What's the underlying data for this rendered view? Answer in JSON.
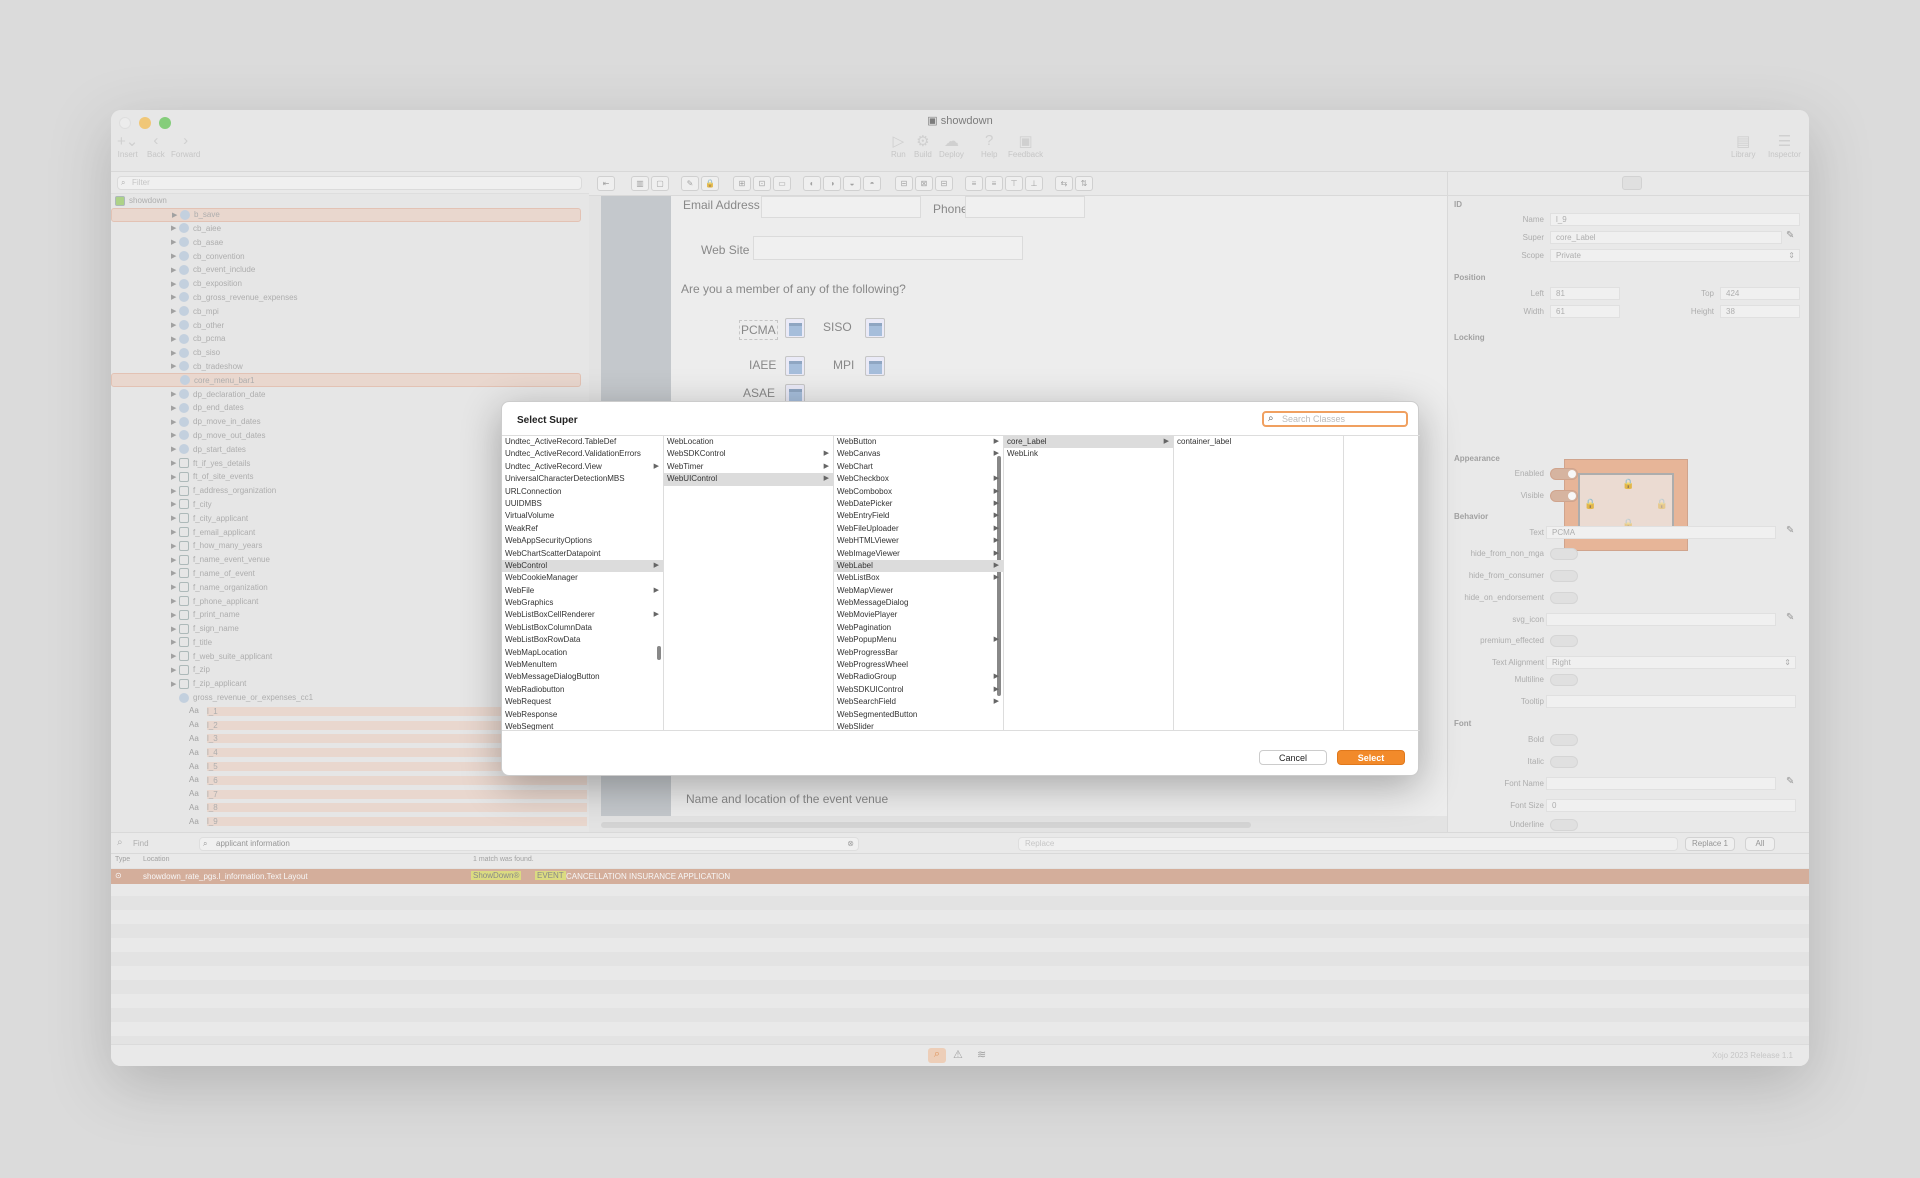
{
  "window": {
    "title": "showdown",
    "version": "Xojo 2023 Release 1.1"
  },
  "toolbar": {
    "left": [
      "Insert",
      "Back",
      "Forward"
    ],
    "mid": [
      "Run",
      "Build",
      "Deploy",
      "Help",
      "Feedback"
    ],
    "right": [
      "Library",
      "Inspector"
    ]
  },
  "navigator": {
    "filter_placeholder": "Filter",
    "root": "showdown",
    "items": [
      "b_save",
      "cb_aiee",
      "cb_asae",
      "cb_convention",
      "cb_event_include",
      "cb_exposition",
      "cb_gross_revenue_expenses",
      "cb_mpi",
      "cb_other",
      "cb_pcma",
      "cb_siso",
      "cb_tradeshow",
      "core_menu_bar1",
      "dp_declaration_date",
      "dp_end_dates",
      "dp_move_in_dates",
      "dp_move_out_dates",
      "dp_start_dates",
      "ft_if_yes_details",
      "ft_of_site_events",
      "f_address_organization",
      "f_city",
      "f_city_applicant",
      "f_email_applicant",
      "f_how_many_years",
      "f_name_event_venue",
      "f_name_of_event",
      "f_name_organization",
      "f_phone_applicant",
      "f_print_name",
      "f_sign_name",
      "f_title",
      "f_web_suite_applicant",
      "f_zip",
      "f_zip_applicant",
      "gross_revenue_or_expenses_cc1",
      "l_1",
      "l_2",
      "l_3",
      "l_4",
      "l_5",
      "l_6",
      "l_7",
      "l_8",
      "l_9"
    ]
  },
  "canvas": {
    "email": "Email Address",
    "phone": "Phone",
    "web": "Web Site",
    "question": "Are you a member of any of the following?",
    "pcma": "PCMA",
    "siso": "SISO",
    "iaee": "IAEE",
    "mpi": "MPI",
    "asae": "ASAE",
    "venue": "Name and location of the event venue"
  },
  "inspector": {
    "sections": {
      "id": "ID",
      "position": "Position",
      "locking": "Locking",
      "appearance": "Appearance",
      "behavior": "Behavior",
      "font": "Font"
    },
    "name_label": "Name",
    "name": "l_9",
    "super_label": "Super",
    "super": "core_Label",
    "scope_label": "Scope",
    "scope": "Private",
    "left_label": "Left",
    "left": "81",
    "top_label": "Top",
    "top": "424",
    "width_label": "Width",
    "width": "61",
    "height_label": "Height",
    "height": "38",
    "enabled": "Enabled",
    "visible": "Visible",
    "text_label": "Text",
    "text": "PCMA",
    "hide1": "hide_from_non_mga",
    "hide2": "hide_from_consumer",
    "hide3": "hide_on_endorsement",
    "svg": "svg_icon",
    "premium": "premium_effected",
    "align_label": "Text Alignment",
    "align": "Right",
    "multiline": "Multiline",
    "tooltip": "Tooltip",
    "bold": "Bold",
    "italic": "Italic",
    "fontname": "Font Name",
    "fontsize_label": "Font Size",
    "fontsize": "0",
    "underline": "Underline"
  },
  "find": {
    "label": "Find",
    "query": "applicant information",
    "replace_placeholder": "Replace",
    "replace1": "Replace 1",
    "all": "All"
  },
  "results": {
    "type": "Type",
    "location": "Location",
    "summary": "1 match was found.",
    "row_loc": "showdown_rate_pgs.l_information.Text Layout",
    "row_hit1": "ShowDown®",
    "row_hit2": "EVENT",
    "row_rest": "CANCELLATION INSURANCE APPLICATION"
  },
  "dialog": {
    "title": "Select Super",
    "search_placeholder": "Search Classes",
    "col1": [
      "Undtec_ActiveRecord.TableDef",
      "Undtec_ActiveRecord.ValidationErrors",
      "Undtec_ActiveRecord.View",
      "UniversalCharacterDetectionMBS",
      "URLConnection",
      "UUIDMBS",
      "VirtualVolume",
      "WeakRef",
      "WebAppSecurityOptions",
      "WebChartScatterDatapoint",
      "WebControl",
      "WebCookieManager",
      "WebFile",
      "WebGraphics",
      "WebListBoxCellRenderer",
      "WebListBoxColumnData",
      "WebListBoxRowData",
      "WebMapLocation",
      "WebMenuItem",
      "WebMessageDialogButton",
      "WebRadiobutton",
      "WebRequest",
      "WebResponse",
      "WebSegment"
    ],
    "col2": [
      "WebLocation",
      "WebSDKControl",
      "WebTimer",
      "WebUIControl"
    ],
    "col3": [
      "WebButton",
      "WebCanvas",
      "WebChart",
      "WebCheckbox",
      "WebCombobox",
      "WebDatePicker",
      "WebEntryField",
      "WebFileUploader",
      "WebHTMLViewer",
      "WebImageViewer",
      "WebLabel",
      "WebListBox",
      "WebMapViewer",
      "WebMessageDialog",
      "WebMoviePlayer",
      "WebPagination",
      "WebPopupMenu",
      "WebProgressBar",
      "WebProgressWheel",
      "WebRadioGroup",
      "WebSDKUIControl",
      "WebSearchField",
      "WebSegmentedButton",
      "WebSlider"
    ],
    "col4": [
      "core_Label",
      "WebLink"
    ],
    "col5": [
      "container_label"
    ],
    "cancel": "Cancel",
    "select": "Select"
  }
}
